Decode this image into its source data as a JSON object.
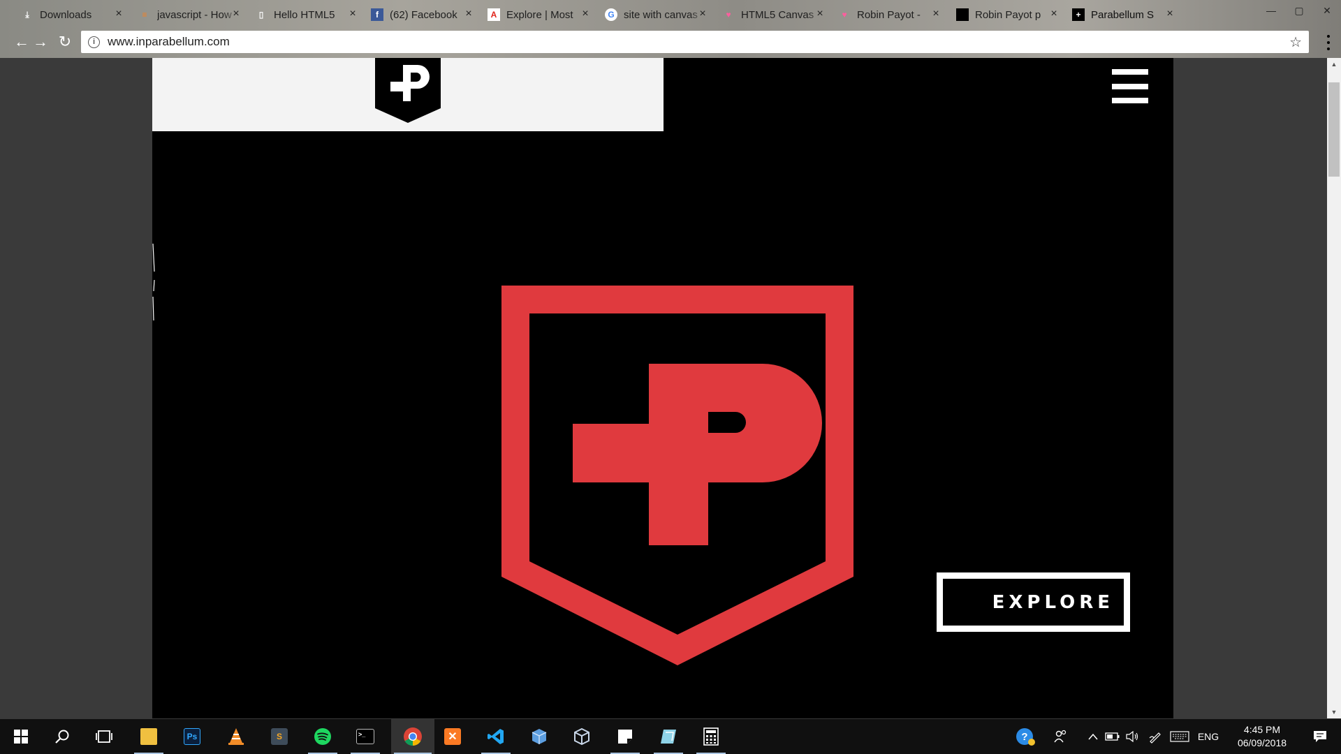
{
  "browser": {
    "tabs": [
      {
        "title": "Downloads",
        "icon": "download-icon"
      },
      {
        "title": "javascript - How",
        "icon": "stackoverflow-icon"
      },
      {
        "title": "Hello HTML5",
        "icon": "page-icon"
      },
      {
        "title": "(62) Facebook",
        "icon": "facebook-icon"
      },
      {
        "title": "Explore | Most",
        "icon": "adobe-icon"
      },
      {
        "title": "site with canvas",
        "icon": "google-icon"
      },
      {
        "title": "HTML5 Canvas",
        "icon": "heart-icon"
      },
      {
        "title": "Robin Payot -",
        "icon": "heart-icon"
      },
      {
        "title": "Robin Payot p",
        "icon": "black-square-icon"
      },
      {
        "title": "Parabellum S",
        "icon": "parabellum-icon"
      }
    ],
    "tab_close": "×",
    "url": "www.inparabellum.com",
    "back_icon": "←",
    "forward_icon": "→",
    "reload_icon": "↻",
    "star_icon": "☆",
    "info_icon": "i"
  },
  "page": {
    "explore_label": "EXPLORE",
    "brand_color": "#e03a3e",
    "background": "#000000",
    "header_bg": "#f3f3f3"
  },
  "taskbar": {
    "apps": [
      "start",
      "search",
      "task-view",
      "file-explorer",
      "photoshop",
      "vlc",
      "sublime",
      "spotify",
      "terminal",
      "chrome",
      "xampp",
      "vscode",
      "virtualbox-cube",
      "virtualbox",
      "sticky-notes",
      "paint",
      "calculator"
    ],
    "language": "ENG",
    "time": "4:45 PM",
    "date": "06/09/2018"
  }
}
